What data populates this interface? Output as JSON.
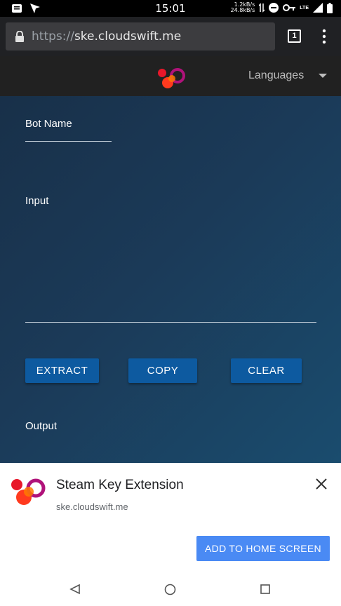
{
  "status_bar": {
    "time": "15:01",
    "upload_speed": "1.2kB/s",
    "download_speed": "24.8kB/s",
    "network": "LTE"
  },
  "browser": {
    "url_scheme": "https://",
    "url_host": "ske.cloudswift.me",
    "tab_count": "1"
  },
  "site_nav": {
    "languages_label": "Languages"
  },
  "form": {
    "bot_name_label": "Bot Name",
    "input_label": "Input",
    "output_label": "Output",
    "extract_label": "EXTRACT",
    "copy_label": "COPY",
    "clear_label": "CLEAR"
  },
  "install_banner": {
    "title": "Steam Key Extension",
    "url": "ske.cloudswift.me",
    "add_label": "ADD TO HOME SCREEN"
  },
  "colors": {
    "button_blue": "#0d5aa0",
    "banner_button": "#4a8af4",
    "background_dark": "#183049"
  }
}
